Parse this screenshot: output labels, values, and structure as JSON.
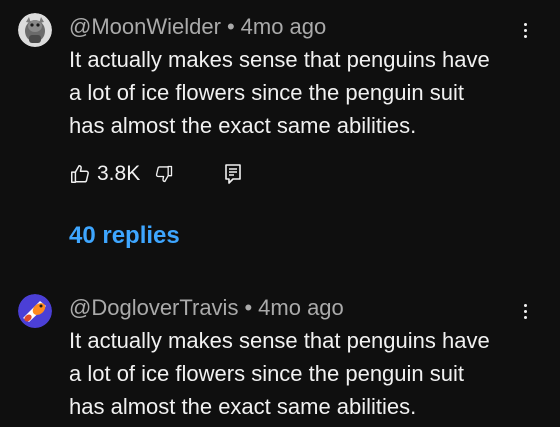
{
  "comments": [
    {
      "author": "@MoonWielder",
      "separator": "•",
      "time": "4mo ago",
      "lines": [
        "It actually makes sense that penguins have",
        "a lot of ice flowers since the penguin suit",
        "has almost the exact same abilities."
      ],
      "like_count": "3.8K",
      "replies_label": "40 replies",
      "avatar_icon": "grey-creature-avatar"
    },
    {
      "author": "@DogloverTravis",
      "separator": "•",
      "time": "4mo ago",
      "lines": [
        "It actually makes sense that penguins have",
        "a lot of ice flowers since the penguin suit",
        "has almost the exact same abilities."
      ],
      "avatar_icon": "dog-avatar"
    }
  ],
  "colors": {
    "background": "#0f0f0f",
    "text": "#f1f1f1",
    "meta": "#aaaaaa",
    "link": "#3ea6ff"
  }
}
